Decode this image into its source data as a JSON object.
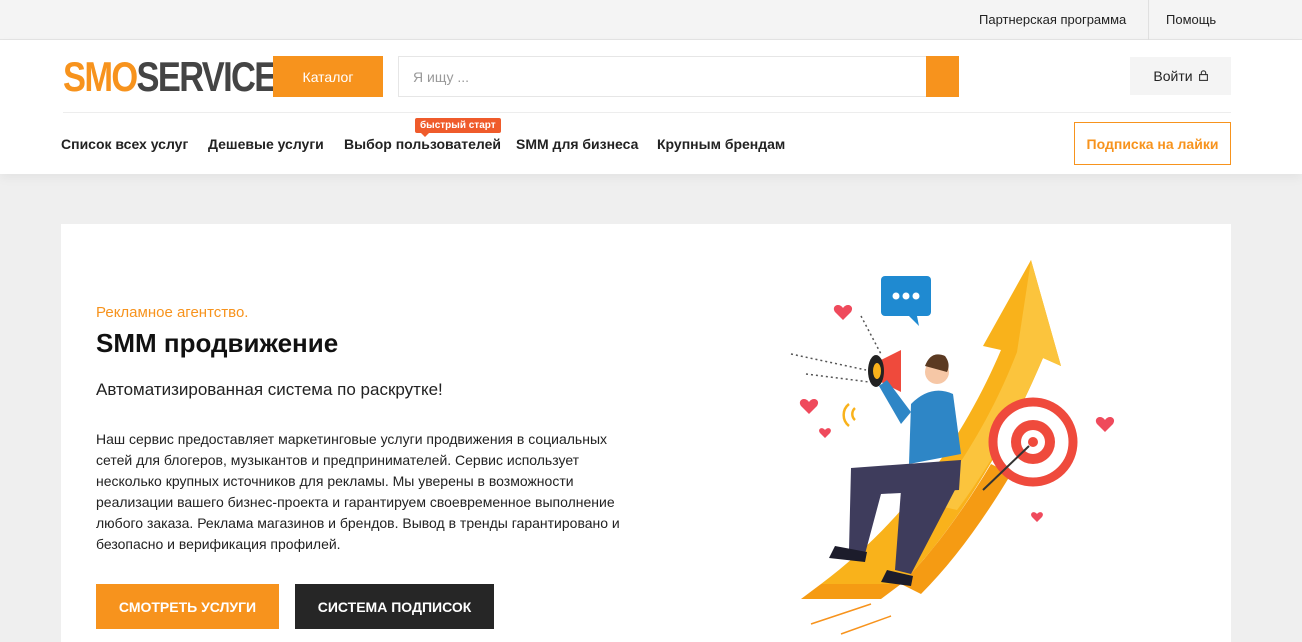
{
  "topbar": {
    "partner_label": "Партнерская программа",
    "help_label": "Помощь"
  },
  "header": {
    "logo_part1": "SMO",
    "logo_part2": "SERVICE",
    "catalog_label": "Каталог",
    "search_placeholder": "Я ищу ...",
    "login_label": "Войти",
    "subscribe_label": "Подписка на лайки"
  },
  "nav": {
    "items": [
      {
        "label": "Список всех услуг"
      },
      {
        "label": "Дешевые услуги"
      },
      {
        "label": "Выбор пользователей"
      },
      {
        "label": "SMM для бизнеса"
      },
      {
        "label": "Крупным брендам"
      }
    ],
    "badge": "быстрый старт"
  },
  "hero": {
    "kicker": "Рекламное агентство.",
    "title": "SMM продвижение",
    "subtitle": "Автоматизированная система по раскрутке!",
    "description": "Наш сервис предоставляет маркетинговые услуги продвижения в социальных сетей для блогеров, музыкантов и предпринимателей. Сервис использует несколько крупных источников для рекламы. Мы уверены в возможности реализации вашего бизнес-проекта и гарантируем своевременное выполнение любого заказа. Реклама магазинов и брендов. Вывод в тренды гарантировано и безопасно и верификация профилей.",
    "btn_services": "СМОТРЕТЬ УСЛУГИ",
    "btn_system": "СИСТЕМА ПОДПИСОК"
  },
  "colors": {
    "accent": "#f7931d",
    "dark": "#262626",
    "badge": "#ef5b2b"
  },
  "icons": {
    "search": "search-icon",
    "lock": "lock-icon",
    "illustration": "megaphone-growth-illustration"
  }
}
